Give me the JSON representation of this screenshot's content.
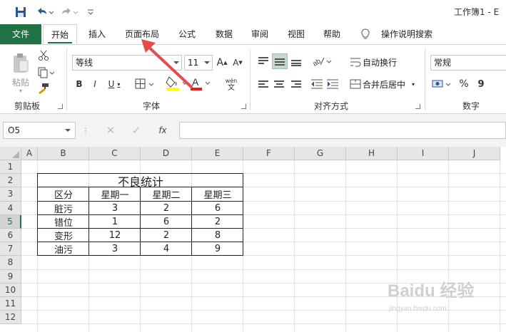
{
  "title_bar": {
    "doc_title": "工作簿1  -  E"
  },
  "tabs": [
    "文件",
    "开始",
    "插入",
    "页面布局",
    "公式",
    "数据",
    "审阅",
    "视图",
    "帮助",
    "操作说明搜索"
  ],
  "ribbon": {
    "clipboard": {
      "paste_label": "粘贴",
      "group_label": "剪贴板"
    },
    "font": {
      "font_name": "等线",
      "font_size": "11",
      "group_label": "字体",
      "wen_label": "wén",
      "wen_char": "文",
      "grow_font": "A",
      "shrink_font": "A",
      "font_color": "A"
    },
    "alignment": {
      "wrap_text": "自动换行",
      "merge_center": "合并后居中",
      "group_label": "对齐方式"
    },
    "number": {
      "format": "常规",
      "percent": "%",
      "comma": "9",
      "group_label": "数字"
    }
  },
  "formula_bar": {
    "name_box": "O5",
    "fx": "fx",
    "value": ""
  },
  "grid": {
    "columns": [
      "A",
      "B",
      "C",
      "D",
      "E",
      "F",
      "G",
      "H",
      "I",
      "J"
    ],
    "rows": [
      "1",
      "2",
      "3",
      "4",
      "5",
      "6",
      "7",
      "8",
      "9",
      "10",
      "11",
      "12"
    ],
    "active_row": "5"
  },
  "table": {
    "title": "不良统计",
    "headers": [
      "区分",
      "星期一",
      "星期二",
      "星期三"
    ],
    "rows": [
      [
        "脏污",
        "3",
        "2",
        "6"
      ],
      [
        "错位",
        "1",
        "6",
        "2"
      ],
      [
        "变形",
        "12",
        "2",
        "8"
      ],
      [
        "油污",
        "3",
        "4",
        "9"
      ]
    ]
  },
  "watermark": {
    "text": "Baidu 经验",
    "sub": "jingyan.baidu.com"
  },
  "colors": {
    "accent": "#217346",
    "highlight": "#ffff00",
    "font_red": "#e0201e",
    "arrow": "#e84a4a"
  }
}
